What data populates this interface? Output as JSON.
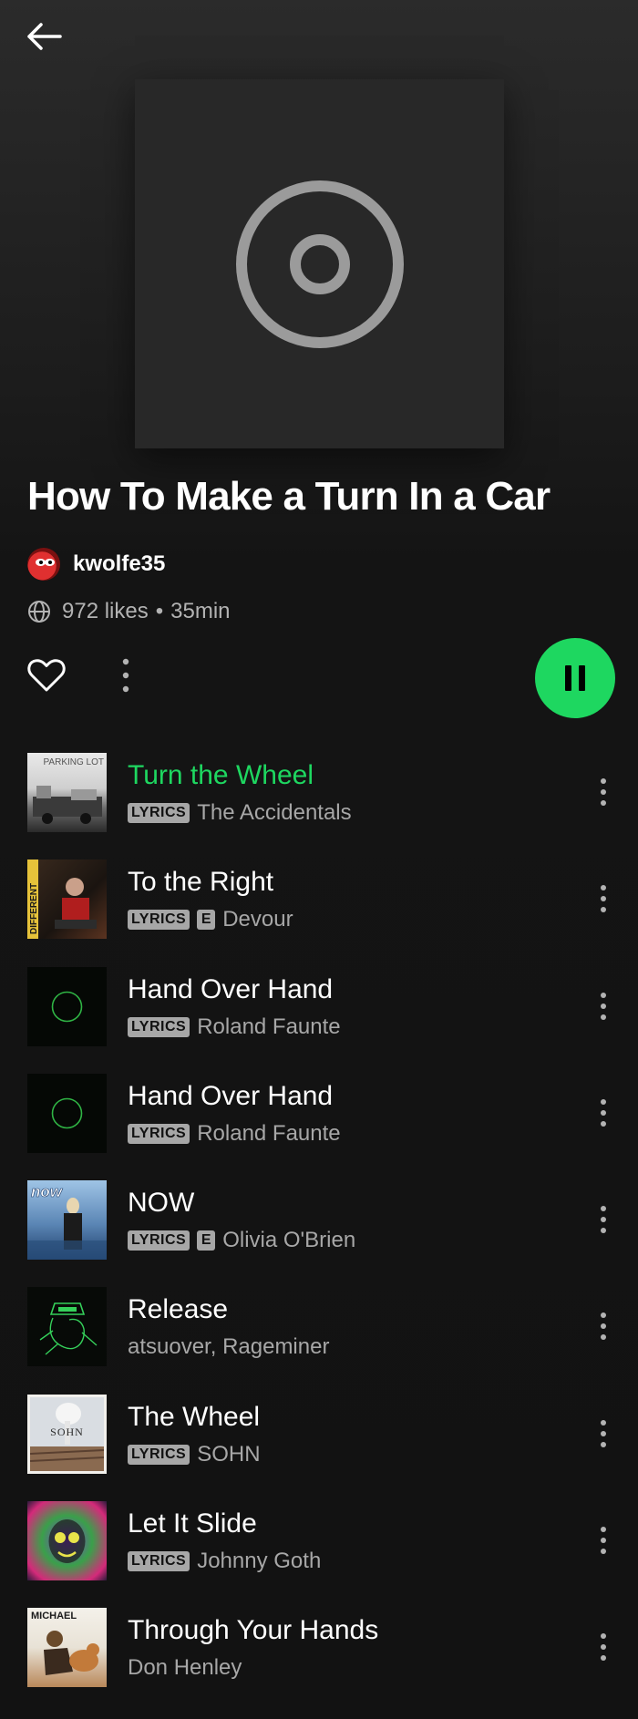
{
  "header": {
    "back_icon": "arrow-left-icon"
  },
  "playlist": {
    "cover_icon": "disc-icon",
    "title": "How To Make a Turn In a Car",
    "owner": "kwolfe35",
    "likes": "972 likes",
    "separator": "•",
    "duration": "35min",
    "globe_icon": "globe-icon"
  },
  "controls": {
    "like_icon": "heart-outline-icon",
    "more_icon": "more-vertical-icon",
    "play_icon": "pause-icon",
    "accent_color": "#1ed760"
  },
  "tracks": [
    {
      "title": "Turn the Wheel",
      "lyrics": "LYRICS",
      "explicit": "",
      "artist": "The Accidentals",
      "playing": true
    },
    {
      "title": "To the Right",
      "lyrics": "LYRICS",
      "explicit": "E",
      "artist": "Devour",
      "playing": false
    },
    {
      "title": "Hand Over Hand",
      "lyrics": "LYRICS",
      "explicit": "",
      "artist": "Roland Faunte",
      "playing": false
    },
    {
      "title": "Hand Over Hand",
      "lyrics": "LYRICS",
      "explicit": "",
      "artist": "Roland Faunte",
      "playing": false
    },
    {
      "title": "NOW",
      "lyrics": "LYRICS",
      "explicit": "E",
      "artist": "Olivia O'Brien",
      "playing": false
    },
    {
      "title": "Release",
      "lyrics": "",
      "explicit": "",
      "artist": "atsuover, Rageminer",
      "playing": false
    },
    {
      "title": "The Wheel",
      "lyrics": "LYRICS",
      "explicit": "",
      "artist": "SOHN",
      "playing": false
    },
    {
      "title": "Let It Slide",
      "lyrics": "LYRICS",
      "explicit": "",
      "artist": "Johnny Goth",
      "playing": false
    },
    {
      "title": "Through Your Hands",
      "lyrics": "",
      "explicit": "",
      "artist": "Don Henley",
      "playing": false
    }
  ],
  "art_text": {
    "t1": "PARKING LOT",
    "t2": "DIFFERENT",
    "t5": "now",
    "t7": "SOHN",
    "t9": "MICHAEL"
  }
}
